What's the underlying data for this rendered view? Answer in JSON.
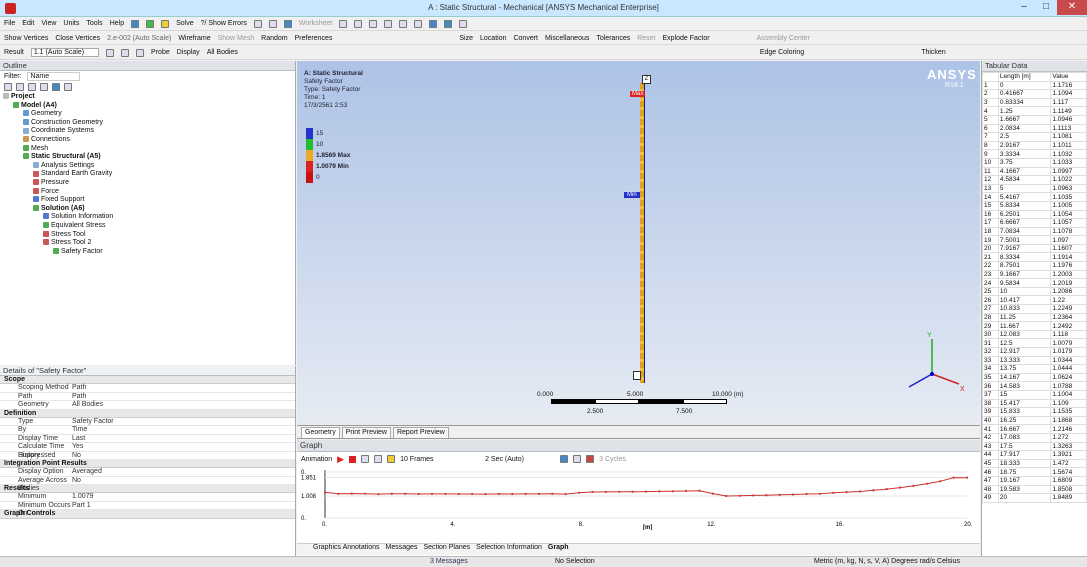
{
  "window": {
    "title": "A : Static Structural - Mechanical [ANSYS Mechanical Enterprise]"
  },
  "menu": [
    "File",
    "Edit",
    "View",
    "Units",
    "Tools",
    "Help"
  ],
  "toolbar1": {
    "solve": "Solve",
    "show_errors": "?/ Show Errors",
    "worksheet": "Worksheet"
  },
  "toolbar2": {
    "show_vertices": "Show Vertices",
    "close_vertices": "Close Vertices",
    "scale_value": "2.e-002 (Auto Scale)",
    "wireframe": "Wireframe",
    "show_mesh": "Show Mesh",
    "random": "Random",
    "preferences": "Preferences",
    "size": "Size",
    "location": "Location",
    "convert": "Convert",
    "miscellaneous": "Miscellaneous",
    "tolerances": "Tolerances",
    "reset": "Reset",
    "explode_factor": "Explode Factor",
    "assembly_center": "Assembly Center"
  },
  "toolbar3": {
    "result": "Result",
    "result_scale": "1.1 (Auto Scale)",
    "probe": "Probe",
    "display": "Display",
    "display_value": "All Bodies",
    "edge_coloring": "Edge Coloring",
    "thicken": "Thicken"
  },
  "outline": {
    "title": "Outline",
    "filter_label": "Filter:",
    "filter_value": "Name",
    "tree": [
      {
        "label": "Project",
        "depth": 0,
        "bold": true,
        "color": "#bbbbbb"
      },
      {
        "label": "Model (A4)",
        "depth": 1,
        "bold": true,
        "color": "#55aa55"
      },
      {
        "label": "Geometry",
        "depth": 2,
        "bold": false,
        "color": "#6699cc"
      },
      {
        "label": "Construction Geometry",
        "depth": 2,
        "bold": false,
        "color": "#6699cc"
      },
      {
        "label": "Coordinate Systems",
        "depth": 2,
        "bold": false,
        "color": "#88aacc"
      },
      {
        "label": "Connections",
        "depth": 2,
        "bold": false,
        "color": "#cc9955"
      },
      {
        "label": "Mesh",
        "depth": 2,
        "bold": false,
        "color": "#55aa55"
      },
      {
        "label": "Static Structural (A5)",
        "depth": 2,
        "bold": true,
        "color": "#55aa55"
      },
      {
        "label": "Analysis Settings",
        "depth": 3,
        "bold": false,
        "color": "#88aacc"
      },
      {
        "label": "Standard Earth Gravity",
        "depth": 3,
        "bold": false,
        "color": "#cc5555"
      },
      {
        "label": "Pressure",
        "depth": 3,
        "bold": false,
        "color": "#cc5555"
      },
      {
        "label": "Force",
        "depth": 3,
        "bold": false,
        "color": "#cc5555"
      },
      {
        "label": "Fixed Support",
        "depth": 3,
        "bold": false,
        "color": "#5577cc"
      },
      {
        "label": "Solution (A6)",
        "depth": 3,
        "bold": true,
        "color": "#55aa55"
      },
      {
        "label": "Solution Information",
        "depth": 4,
        "bold": false,
        "color": "#5577cc"
      },
      {
        "label": "Equivalent Stress",
        "depth": 4,
        "bold": false,
        "color": "#55aa55"
      },
      {
        "label": "Stress Tool",
        "depth": 4,
        "bold": false,
        "color": "#cc5555"
      },
      {
        "label": "Stress Tool 2",
        "depth": 4,
        "bold": false,
        "color": "#cc5555"
      },
      {
        "label": "Safety Factor",
        "depth": 5,
        "bold": false,
        "color": "#55aa55"
      }
    ]
  },
  "details": {
    "title": "Details of \"Safety Factor\"",
    "rows": [
      {
        "section": "Scope"
      },
      {
        "k": "Scoping Method",
        "v": "Path"
      },
      {
        "k": "Path",
        "v": "Path"
      },
      {
        "k": "Geometry",
        "v": "All Bodies"
      },
      {
        "section": "Definition"
      },
      {
        "k": "Type",
        "v": "Safety Factor"
      },
      {
        "k": "By",
        "v": "Time"
      },
      {
        "k": "Display Time",
        "v": "Last"
      },
      {
        "k": "Calculate Time History",
        "v": "Yes"
      },
      {
        "k": "Suppressed",
        "v": "No"
      },
      {
        "section": "Integration Point Results"
      },
      {
        "k": "Display Option",
        "v": "Averaged"
      },
      {
        "k": "Average Across Bodies",
        "v": "No"
      },
      {
        "section": "Results"
      },
      {
        "k": "Minimum",
        "v": "1.0079"
      },
      {
        "k": "Minimum Occurs On",
        "v": "Part 1"
      },
      {
        "section": "Graph Controls"
      }
    ]
  },
  "viewport": {
    "info": [
      "A: Static Structural",
      "Safety Factor",
      "Type: Safety Factor",
      "Time: 1",
      "17/3/2561 2:53"
    ],
    "legend": [
      {
        "label": "15",
        "color": "#2233cc"
      },
      {
        "label": "10",
        "color": "#22bb33"
      },
      {
        "label": "1.8569 Max",
        "color": "#eeaa22"
      },
      {
        "label": "1.0079 Min",
        "color": "#dd2222"
      },
      {
        "label": "0",
        "color": "#cc1111"
      }
    ],
    "brand": "ANSYS",
    "version": "R18.1",
    "max_tag": "Max",
    "min_tag": "Min",
    "scale_labels": [
      "0.000",
      "5.000",
      "10.000 (m)",
      "2.500",
      "7.500"
    ]
  },
  "viewport_tabs": [
    "Geometry",
    "Print Preview",
    "Report Preview"
  ],
  "graph": {
    "title": "Graph",
    "animation_label": "Animation",
    "frames_label": "10 Frames",
    "speed_label": "2 Sec (Auto)",
    "cycles_label": "3 Cycles",
    "y_ticks": [
      "0.",
      "1.851",
      "1.008",
      "0."
    ],
    "x_ticks": [
      "0.",
      "4.",
      "8.",
      "12.",
      "16.",
      "20."
    ],
    "x_unit": "[m]"
  },
  "bottom_tabs": [
    "Graphics Annotations",
    "Messages",
    "Section Planes",
    "Selection Information",
    "Graph"
  ],
  "chart_data": {
    "type": "line",
    "xlabel": "[m]",
    "ylabel": "",
    "xlim": [
      0,
      20
    ],
    "ylim": [
      0,
      2.2
    ],
    "x": [
      0,
      0.41667,
      0.83334,
      1.25,
      1.6667,
      2.0834,
      2.5,
      2.9167,
      3.3334,
      3.75,
      4.1667,
      4.5834,
      5,
      5.4167,
      5.8334,
      6.2501,
      6.6667,
      7.0834,
      7.5001,
      7.9167,
      8.3334,
      8.7501,
      9.1667,
      9.5834,
      10,
      10.417,
      10.833,
      11.25,
      11.667,
      12.083,
      12.5,
      12.917,
      13.333,
      13.75,
      14.167,
      14.583,
      15,
      15.417,
      15.833,
      16.25,
      16.667,
      17.083,
      17.5,
      17.917,
      18.333,
      18.75,
      19.167,
      19.583,
      20
    ],
    "y": [
      1.1716,
      1.1094,
      1.117,
      1.1149,
      1.0946,
      1.1113,
      1.1081,
      1.1011,
      1.1032,
      1.1033,
      1.0997,
      1.1022,
      1.0963,
      1.1035,
      1.1005,
      1.1054,
      1.1057,
      1.1078,
      1.097,
      1.1607,
      1.1914,
      1.1976,
      1.2003,
      1.2019,
      1.2086,
      1.22,
      1.2249,
      1.2364,
      1.2492,
      1.118,
      1.0079,
      1.0179,
      1.0344,
      1.0444,
      1.0624,
      1.0788,
      1.1004,
      1.109,
      1.1535,
      1.1868,
      1.2146,
      1.272,
      1.3263,
      1.3921,
      1.472,
      1.5674,
      1.6809,
      1.8508,
      1.8489
    ]
  },
  "tabular": {
    "title": "Tabular Data",
    "col_length": "Length [m]",
    "col_value": "Value"
  },
  "status": {
    "messages": "3 Messages",
    "selection": "No Selection",
    "units": "Metric (m, kg, N, s, V, A)  Degrees  rad/s  Celsius"
  }
}
